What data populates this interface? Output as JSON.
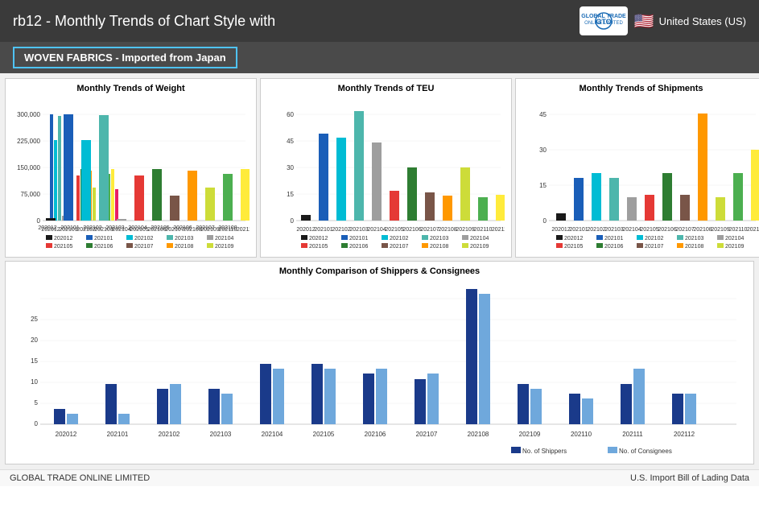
{
  "header": {
    "title": "rb12 - Monthly Trends of Chart Style with",
    "filter_label": "WOVEN FABRICS - Imported from Japan",
    "country": "United States (US)",
    "flag": "🇺🇸"
  },
  "charts": {
    "weight_title": "Monthly Trends of Weight",
    "teu_title": "Monthly Trends of TEU",
    "shipments_title": "Monthly Trends of Shipments",
    "comparison_title": "Monthly Comparison of Shippers & Consignees"
  },
  "legend": {
    "shippers": "No. of Shippers",
    "consignees": "No. of Consignees"
  },
  "footer": {
    "left": "GLOBAL TRADE ONLINE LIMITED",
    "right": "U.S. Import Bill of Lading Data"
  }
}
